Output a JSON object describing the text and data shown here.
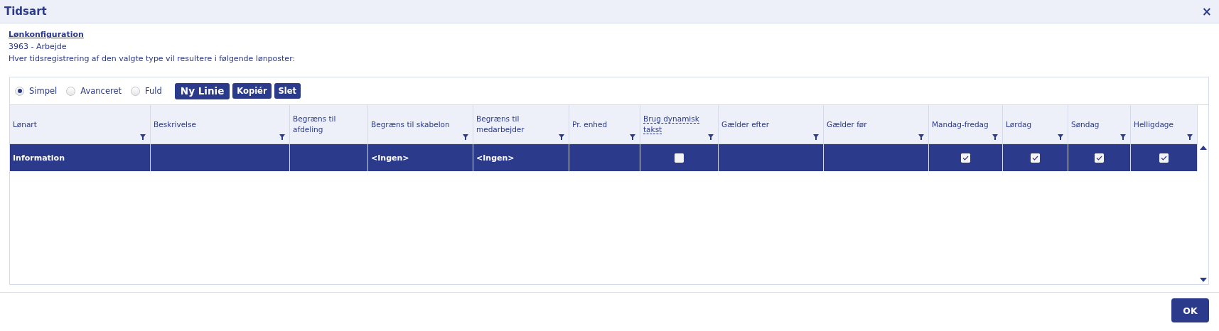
{
  "window": {
    "title": "Tidsart",
    "close": "×"
  },
  "info": {
    "link": "Lønkonfiguration",
    "code": "3963 - Arbejde",
    "description": "Hver tidsregistrering af den valgte type vil resultere i følgende lønposter:"
  },
  "modes": [
    {
      "label": "Simpel",
      "selected": true
    },
    {
      "label": "Avanceret",
      "selected": false
    },
    {
      "label": "Fuld",
      "selected": false
    }
  ],
  "buttons": [
    {
      "label": "Ny Linie",
      "kind": "large"
    },
    {
      "label": "Kopiér",
      "kind": "small"
    },
    {
      "label": "Slet",
      "kind": "small"
    }
  ],
  "table": {
    "columns": [
      {
        "label": "Lønart",
        "filter": true,
        "hint": false
      },
      {
        "label": "Beskrivelse",
        "filter": true,
        "hint": false
      },
      {
        "label": "Begræns til afdeling",
        "filter": false,
        "hint": false
      },
      {
        "label": "Begræns til skabelon",
        "filter": true,
        "hint": false
      },
      {
        "label": "Begræns til medarbejder",
        "filter": true,
        "hint": false
      },
      {
        "label": "Pr. enhed",
        "filter": true,
        "hint": false
      },
      {
        "label": "Brug dynamisk takst",
        "filter": true,
        "hint": true
      },
      {
        "label": "Gælder efter",
        "filter": true,
        "hint": false
      },
      {
        "label": "Gælder før",
        "filter": true,
        "hint": false
      },
      {
        "label": "Mandag-fredag",
        "filter": true,
        "hint": false
      },
      {
        "label": "Lørdag",
        "filter": true,
        "hint": false
      },
      {
        "label": "Søndag",
        "filter": true,
        "hint": false
      },
      {
        "label": "Helligdage",
        "filter": true,
        "hint": false
      }
    ],
    "rows": [
      {
        "selected": true,
        "cells": [
          {
            "kind": "text",
            "text": "Information"
          },
          {
            "kind": "text",
            "text": ""
          },
          {
            "kind": "text",
            "text": ""
          },
          {
            "kind": "text",
            "text": "<Ingen>"
          },
          {
            "kind": "text",
            "text": "<Ingen>"
          },
          {
            "kind": "text",
            "text": ""
          },
          {
            "kind": "checkbox",
            "checked": false
          },
          {
            "kind": "text",
            "text": ""
          },
          {
            "kind": "text",
            "text": ""
          },
          {
            "kind": "checkbox",
            "checked": true
          },
          {
            "kind": "checkbox",
            "checked": true
          },
          {
            "kind": "checkbox",
            "checked": true
          },
          {
            "kind": "checkbox",
            "checked": true
          }
        ]
      }
    ]
  },
  "footer": {
    "ok": "OK"
  }
}
